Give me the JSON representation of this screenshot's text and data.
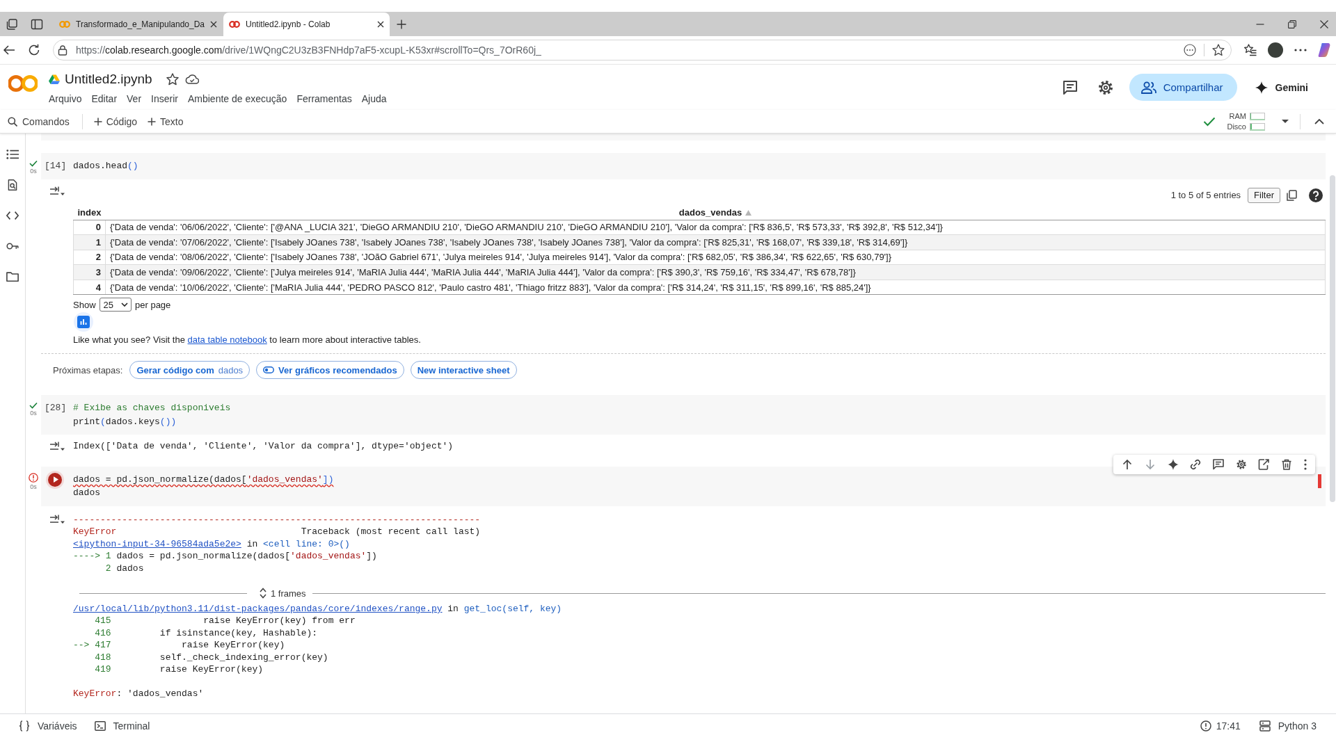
{
  "browser": {
    "tabs": [
      {
        "title": "Transformado_e_Manipulando_Da",
        "selected": false
      },
      {
        "title": "Untitled2.ipynb - Colab",
        "selected": true
      }
    ],
    "url": {
      "scheme": "https://",
      "host": "colab.research.google.com",
      "path": "/drive/1WQngC2U3zB3FNHdp7aF5-xcupL-K53xr#scrollTo=Qrs_7OrR60j_"
    }
  },
  "header": {
    "title": "Untitled2.ipynb",
    "menu": [
      "Arquivo",
      "Editar",
      "Ver",
      "Inserir",
      "Ambiente de execução",
      "Ferramentas",
      "Ajuda"
    ],
    "share": "Compartilhar",
    "gemini": "Gemini"
  },
  "toolbar": {
    "search": "Comandos",
    "add": [
      "Código",
      "Texto"
    ],
    "connected": true,
    "resources": [
      {
        "label": "RAM",
        "level": 0.05
      },
      {
        "label": "Disco",
        "level": 0.1
      }
    ]
  },
  "cells": [
    {
      "failed": false,
      "focused": false,
      "count": "[14]",
      "duration": "0s",
      "lines": [
        {
          "flagged": false,
          "tokens": [
            {
              "text": "dados.head",
              "kind": "plain"
            },
            {
              "text": "()",
              "kind": "paren"
            }
          ]
        }
      ],
      "output": {
        "kind": "table",
        "entries": "1 to 5 of 5 entries",
        "filter": "Filter",
        "columns": [
          {
            "label": "index",
            "sorted": false
          },
          {
            "label": "dados_vendas",
            "sorted": true
          }
        ],
        "rows": [
          [
            "0",
            "{'Data de venda': '06/06/2022', 'Cliente': ['@ANA _LUCIA 321', 'DieGO ARMANDIU 210', 'DieGO ARMANDIU 210', 'DieGO ARMANDIU 210'], 'Valor da compra': ['R$ 836,5', 'R$ 573,33', 'R$ 392,8', 'R$ 512,34']}"
          ],
          [
            "1",
            "{'Data de venda': '07/06/2022', 'Cliente': ['Isabely JOanes 738', 'Isabely JOanes 738', 'Isabely JOanes 738', 'Isabely JOanes 738'], 'Valor da compra': ['R$ 825,31', 'R$ 168,07', 'R$ 339,18', 'R$ 314,69']}"
          ],
          [
            "2",
            "{'Data de venda': '08/06/2022', 'Cliente': ['Isabely JOanes 738', 'JOãO Gabriel 671', 'Julya meireles 914', 'Julya meireles 914'], 'Valor da compra': ['R$ 682,05', 'R$ 386,34', 'R$ 622,65', 'R$ 630,79']}"
          ],
          [
            "3",
            "{'Data de venda': '09/06/2022', 'Cliente': ['Julya meireles 914', 'MaRIA Julia 444', 'MaRIA Julia 444', 'MaRIA Julia 444'], 'Valor da compra': ['R$ 390,3', 'R$ 759,16', 'R$ 334,47', 'R$ 678,78']}"
          ],
          [
            "4",
            "{'Data de venda': '10/06/2022', 'Cliente': ['MaRIA Julia 444', 'PEDRO PASCO 812', 'Paulo castro 481', 'Thiago fritzz 883'], 'Valor da compra': ['R$ 314,24', 'R$ 311,15', 'R$ 899,16', 'R$ 885,24']}"
          ]
        ],
        "page_size": {
          "label": "Show",
          "value": "25",
          "suffix": "per page"
        },
        "promo": {
          "before": "Like what you see? Visit the",
          "link": "data table notebook",
          "after": "to learn more about interactive tables."
        },
        "next_steps": {
          "label": "Próximas etapas:",
          "buttons": [
            {
              "label": "Gerar código com",
              "variable": "dados",
              "kind": "code"
            },
            {
              "label": "Ver gráficos recomendados",
              "kind": "charts"
            },
            {
              "label": "New interactive sheet",
              "kind": "sheet"
            }
          ]
        }
      }
    },
    {
      "failed": false,
      "focused": false,
      "count": "[28]",
      "duration": "0s",
      "lines": [
        {
          "flagged": false,
          "tokens": [
            {
              "text": "# Exibe as chaves disponiveis",
              "kind": "comment"
            }
          ]
        },
        {
          "flagged": false,
          "tokens": [
            {
              "text": "print",
              "kind": "plain"
            },
            {
              "text": "(",
              "kind": "paren"
            },
            {
              "text": "dados.keys",
              "kind": "plain"
            },
            {
              "text": "())",
              "kind": "paren"
            }
          ]
        }
      ],
      "output": {
        "kind": "text",
        "lines": [
          "Index(['Data de venda', 'Cliente', 'Valor da compra'], dtype='object')"
        ]
      }
    },
    {
      "failed": true,
      "focused": true,
      "duration": "0s",
      "lines": [
        {
          "flagged": true,
          "tokens": [
            {
              "text": "dados = pd.json_normalize(dados[",
              "kind": "plain"
            },
            {
              "text": "'dados_vendas'",
              "kind": "string"
            },
            {
              "text": "])",
              "kind": "paren"
            }
          ]
        },
        {
          "flagged": false,
          "tokens": [
            {
              "text": "dados",
              "kind": "plain"
            }
          ]
        }
      ],
      "output": {
        "kind": "traceback",
        "header": [
          [
            {
              "text": "---------------------------------------------------------------------------",
              "kind": "error"
            }
          ],
          [
            {
              "text": "KeyError",
              "kind": "error"
            },
            {
              "text": "                                  Traceback (most recent call last)",
              "kind": "plain"
            }
          ],
          [
            {
              "text": "<ipython-input-34-96584ada5e2e>",
              "kind": "link"
            },
            {
              "text": " in ",
              "kind": "plain"
            },
            {
              "text": "<cell line: 0>()",
              "kind": "func"
            }
          ],
          [
            {
              "text": "----> 1 ",
              "kind": "lineno"
            },
            {
              "text": "dados = pd.json_normalize(dados[",
              "kind": "plain"
            },
            {
              "text": "'dados_vendas'",
              "kind": "string"
            },
            {
              "text": "])",
              "kind": "plain"
            }
          ],
          [
            {
              "text": "      2 ",
              "kind": "lineno"
            },
            {
              "text": "dados",
              "kind": "plain"
            }
          ]
        ],
        "frames_label": "1 frames",
        "frame": [
          [
            {
              "text": "/usr/local/lib/python3.11/dist-packages/pandas/core/indexes/range.py",
              "kind": "link"
            },
            {
              "text": " in ",
              "kind": "plain"
            },
            {
              "text": "get_loc(self, key)",
              "kind": "func"
            }
          ],
          [
            {
              "text": "    415 ",
              "kind": "lineno"
            },
            {
              "text": "                raise KeyError(key) from err",
              "kind": "plain"
            }
          ],
          [
            {
              "text": "    416 ",
              "kind": "lineno"
            },
            {
              "text": "        if isinstance(key, Hashable):",
              "kind": "plain"
            }
          ],
          [
            {
              "text": "--> 417 ",
              "kind": "lineno"
            },
            {
              "text": "            raise KeyError(key)",
              "kind": "plain"
            }
          ],
          [
            {
              "text": "    418 ",
              "kind": "lineno"
            },
            {
              "text": "        self._check_indexing_error(key)",
              "kind": "plain"
            }
          ],
          [
            {
              "text": "    419 ",
              "kind": "lineno"
            },
            {
              "text": "        raise KeyError(key)",
              "kind": "plain"
            }
          ]
        ],
        "error": [
          {
            "text": "KeyError",
            "kind": "error"
          },
          {
            "text": ": 'dados_vendas'",
            "kind": "plain"
          }
        ]
      }
    }
  ],
  "status_bar": {
    "items": [
      {
        "label": "Variáveis",
        "kind": "variables"
      },
      {
        "label": "Terminal",
        "kind": "terminal"
      }
    ],
    "time": "17:41",
    "runtime": "Python 3"
  }
}
